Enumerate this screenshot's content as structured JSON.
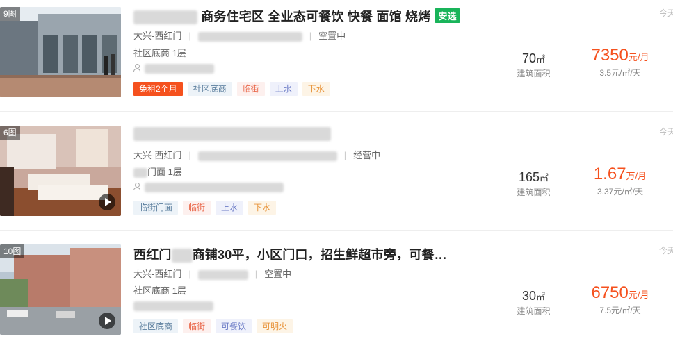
{
  "listings": [
    {
      "photo_count": "9图",
      "has_video": false,
      "title": "商务住宅区 全业态可餐饮 快餐 面馆 烧烤",
      "badge": "安选",
      "district": "大兴-西红门",
      "status": "空置中",
      "floor": "社区底商 1层",
      "tags": [
        "免租2个月",
        "社区底商",
        "临街",
        "上水",
        "下水"
      ],
      "area": "70",
      "area_unit": "㎡",
      "area_label": "建筑面积",
      "price": "7350",
      "price_unit": "元/月",
      "unit_price": "3.5元/㎡/天",
      "time": "今天"
    },
    {
      "photo_count": "6图",
      "has_video": true,
      "title": "",
      "badge": "",
      "district": "大兴-西红门",
      "status": "经营中",
      "floor": "门面 1层",
      "tags": [
        "临街门面",
        "临街",
        "上水",
        "下水"
      ],
      "area": "165",
      "area_unit": "㎡",
      "area_label": "建筑面积",
      "price": "1.67",
      "price_unit": "万/月",
      "unit_price": "3.37元/㎡/天",
      "time": "今天"
    },
    {
      "photo_count": "10图",
      "has_video": true,
      "title_prefix": "西红门",
      "title": "商铺30平，小区门口，招生鲜超市旁，可餐…",
      "badge": "",
      "district": "大兴-西红门",
      "status": "空置中",
      "floor": "社区底商 1层",
      "tags": [
        "社区底商",
        "临街",
        "可餐饮",
        "可明火"
      ],
      "area": "30",
      "area_unit": "㎡",
      "area_label": "建筑面积",
      "price": "6750",
      "price_unit": "元/月",
      "unit_price": "7.5元/㎡/天",
      "time": "今天"
    }
  ],
  "icons": {
    "contact": "user-icon",
    "video": "play-icon"
  },
  "colors": {
    "price": "#f5511e",
    "badge_select": "#19b45a",
    "tag_free": "#f5511e"
  }
}
